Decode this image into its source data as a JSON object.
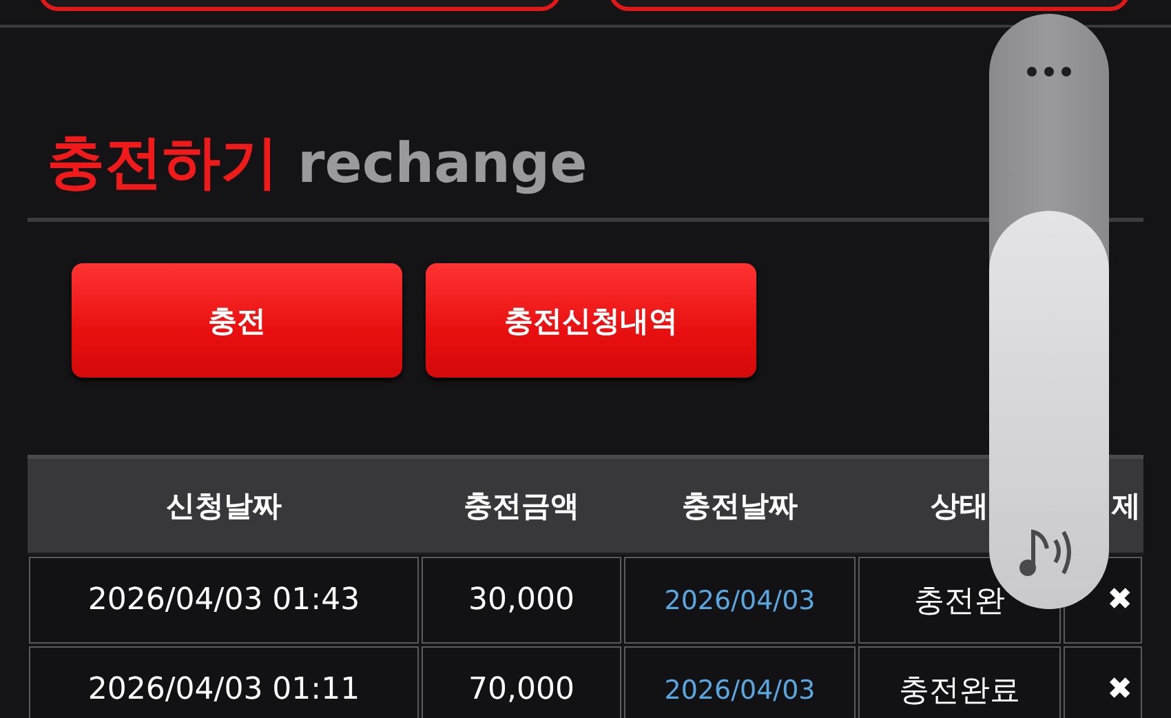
{
  "section_title": {
    "korean": "충전하기",
    "english": "rechange"
  },
  "actions": [
    {
      "label": "충전"
    },
    {
      "label": "충전신청내역"
    }
  ],
  "table": {
    "columns": [
      "신청날짜",
      "충전금액",
      "충전날짜",
      "상태",
      "제"
    ],
    "rows": [
      {
        "requested": "2026/04/03 01:43",
        "amount": "30,000",
        "charged": "2026/04/03",
        "status": "충전완",
        "delete": "✖"
      },
      {
        "requested": "2026/04/03 01:11",
        "amount": "70,000",
        "charged": "2026/04/03",
        "status": "충전완료",
        "delete": "✖"
      }
    ]
  },
  "volume_panel": {
    "level": 0.67
  }
}
